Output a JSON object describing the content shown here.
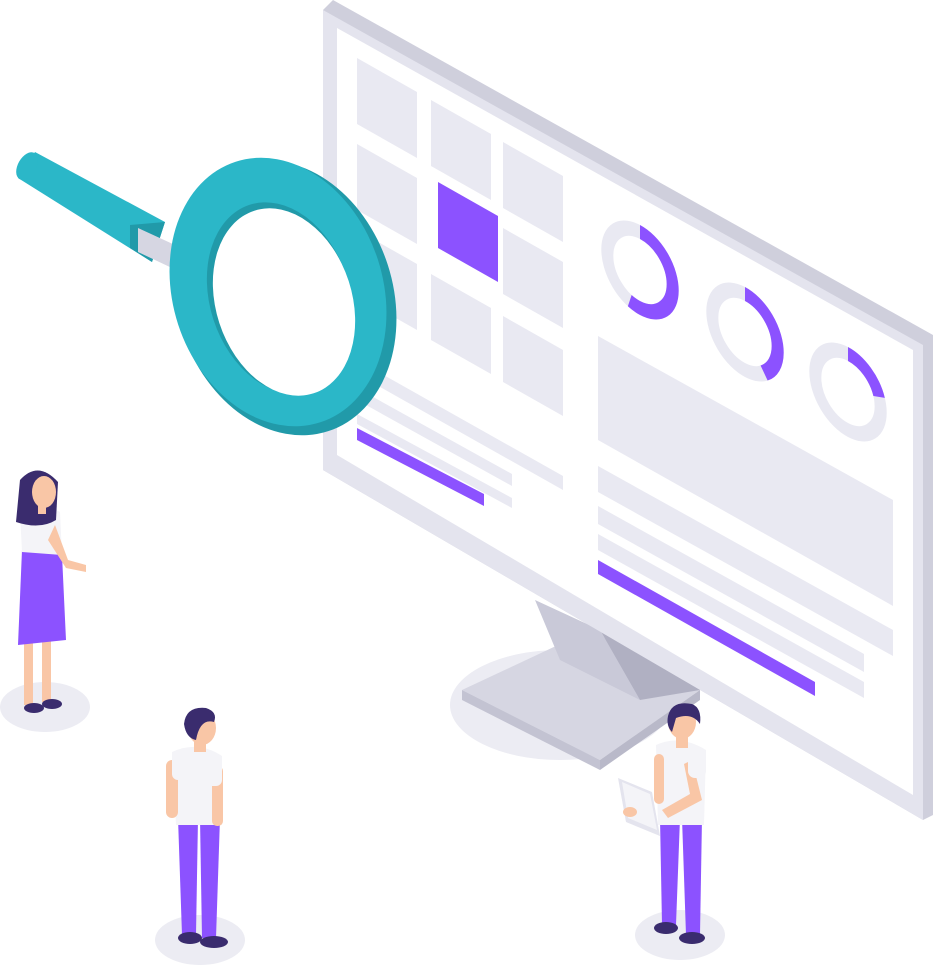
{
  "illustration": {
    "subject": "isometric-monitor-analytics-search",
    "colors": {
      "background": "#ffffff",
      "monitor_frame": "#e4e4ee",
      "monitor_frame_edge": "#cfcfdc",
      "monitor_screen": "#ffffff",
      "tile": "#e9e9f2",
      "accent_purple": "#8c52ff",
      "magnifier_teal": "#2bb7c8",
      "magnifier_teal_dark": "#219aa9",
      "stand": "#d6d6e2",
      "stand_dark": "#b9b9c9",
      "skin": "#f9c6a6",
      "hair": "#3a2c6e",
      "shirt": "#f4f4f8",
      "pants_skirt": "#8c52ff",
      "shoes": "#3a2c6e",
      "shadow": "#ececf3"
    },
    "donut_progress": [
      0.55,
      0.4,
      0.2
    ],
    "people": [
      "woman-standing",
      "man-looking-at-screen",
      "man-holding-tablet"
    ]
  }
}
